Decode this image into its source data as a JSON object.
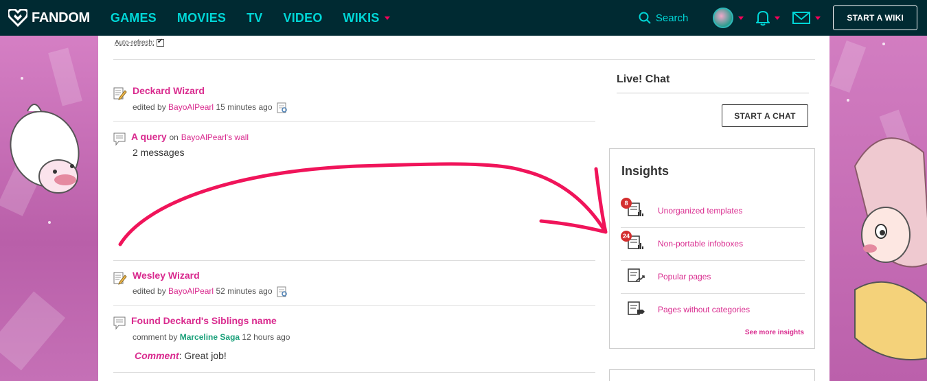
{
  "nav": {
    "brand": "FANDOM",
    "links": [
      "GAMES",
      "MOVIES",
      "TV",
      "VIDEO",
      "WIKIS"
    ],
    "search_label": "Search",
    "start_wiki": "START A WIKI"
  },
  "page": {
    "auto_refresh_label": "Auto-refresh:"
  },
  "activity": [
    {
      "title": "Deckard Wizard",
      "prefix": "edited by",
      "user": "BayoAlPearl",
      "time": "15 minutes ago"
    },
    {
      "title": "A query",
      "on_label": "on",
      "wall": "BayoAlPearl's wall",
      "messages": "2 messages"
    },
    {
      "title": "Wesley Wizard",
      "prefix": "edited by",
      "user": "BayoAlPearl",
      "time": "52 minutes ago"
    },
    {
      "title": "Found Deckard's Siblings name",
      "prefix": "comment by",
      "user": "Marceline Saga",
      "time": "12 hours ago",
      "comment_label": "Comment",
      "comment_text": ": Great job!"
    }
  ],
  "live_chat": {
    "title": "Live! Chat",
    "button": "START A CHAT"
  },
  "insights": {
    "title": "Insights",
    "items": [
      {
        "label": "Unorganized templates",
        "badge": "8"
      },
      {
        "label": "Non-portable infoboxes",
        "badge": "24"
      },
      {
        "label": "Popular pages"
      },
      {
        "label": "Pages without categories"
      }
    ],
    "see_more": "See more insights"
  },
  "colors": {
    "nav_bg": "#002a32",
    "nav_accent": "#00d6d6",
    "link": "#d92a8e",
    "badge": "#d42e2e",
    "annotation": "#f0145a"
  }
}
